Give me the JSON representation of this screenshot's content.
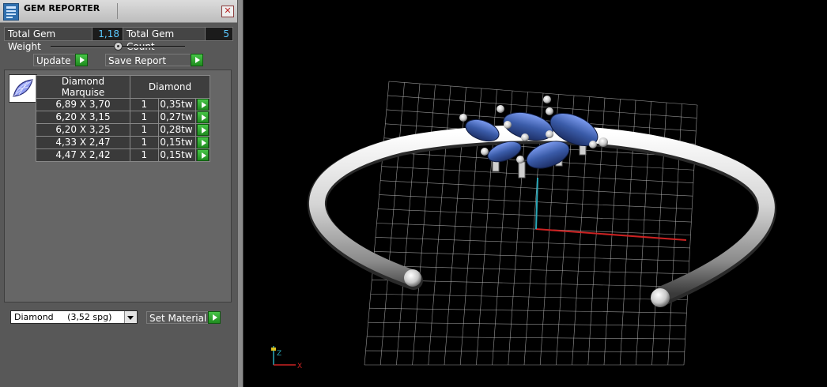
{
  "window": {
    "title": "GEM REPORTER",
    "close_glyph": "✕"
  },
  "stats": {
    "weight_label": "Total Gem Weight",
    "weight_value": "1,18",
    "count_label": "Total Gem Count",
    "count_value": "5"
  },
  "buttons": {
    "update": "Update",
    "save_report": "Save Report",
    "set_material": "Set Material"
  },
  "table": {
    "header": {
      "shape": "Diamond Marquise",
      "material": "Diamond"
    },
    "rows": [
      {
        "size": "6,89 X 3,70",
        "qty": "1",
        "weight": "0,35tw"
      },
      {
        "size": "6,20 X 3,15",
        "qty": "1",
        "weight": "0,27tw"
      },
      {
        "size": "6,20 X 3,25",
        "qty": "1",
        "weight": "0,28tw"
      },
      {
        "size": "4,33 X 2,47",
        "qty": "1",
        "weight": "0,15tw"
      },
      {
        "size": "4,47 X 2,42",
        "qty": "1",
        "weight": "0,15tw"
      }
    ]
  },
  "material": {
    "selected": "Diamond     (3,52 spg)"
  },
  "axis_labels": {
    "z": "Z",
    "x": "X"
  },
  "icons": {
    "app": "gem-reporter-app-icon",
    "close": "close-icon",
    "gem": "marquise-gem-icon",
    "action": "green-arrow-icon",
    "dropdown": "chevron-down-icon"
  },
  "colors": {
    "panel_bg": "#585858",
    "value_text": "#5bc8ff",
    "action_green": "#2ea82e",
    "gem_blue": "#3a5ba8",
    "grid": "#c8c8c8",
    "axis_x": "#cc2222",
    "axis_z": "#2aa8b8"
  }
}
